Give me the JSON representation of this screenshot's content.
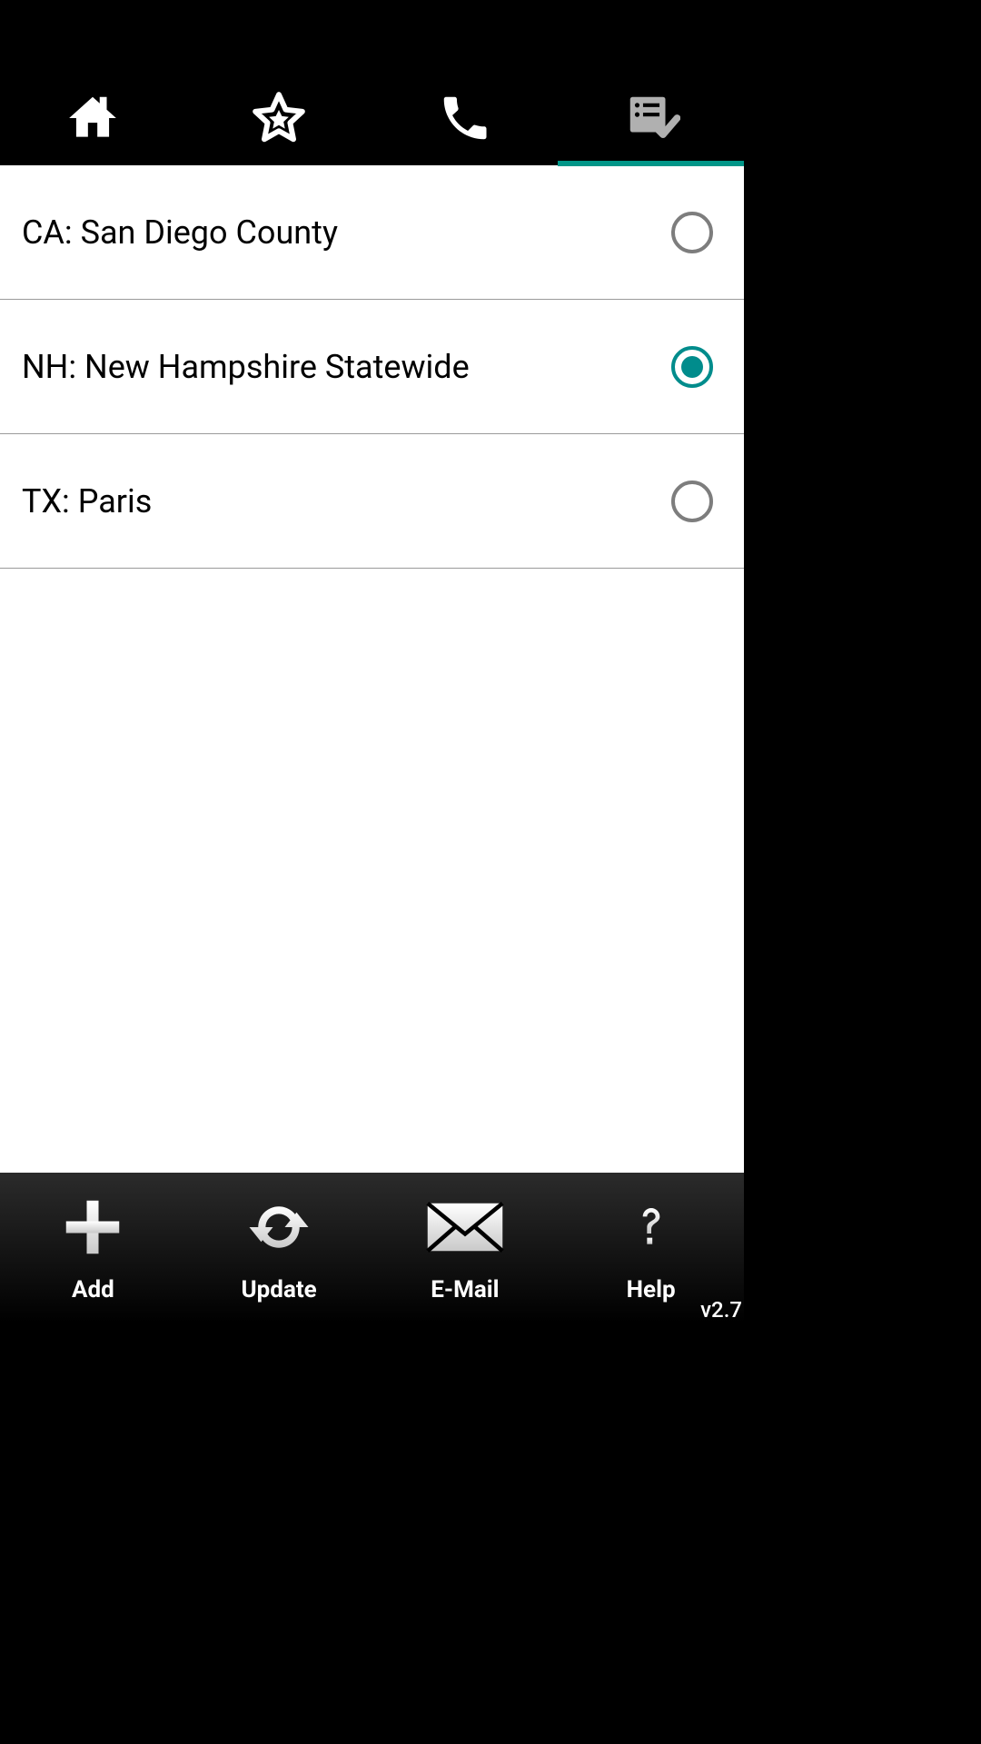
{
  "top_tabs": {
    "home": "home",
    "favorites": "favorites",
    "call": "call",
    "list": "list",
    "active_index": 3
  },
  "list": {
    "items": [
      {
        "label": "CA: San Diego County",
        "selected": false
      },
      {
        "label": "NH: New Hampshire Statewide",
        "selected": true
      },
      {
        "label": "TX: Paris",
        "selected": false
      }
    ]
  },
  "bottom_bar": {
    "add": "Add",
    "update": "Update",
    "email": "E-Mail",
    "help": "Help"
  },
  "version": "v2.7",
  "colors": {
    "accent": "#009688",
    "radio_selected": "#008c8c"
  }
}
